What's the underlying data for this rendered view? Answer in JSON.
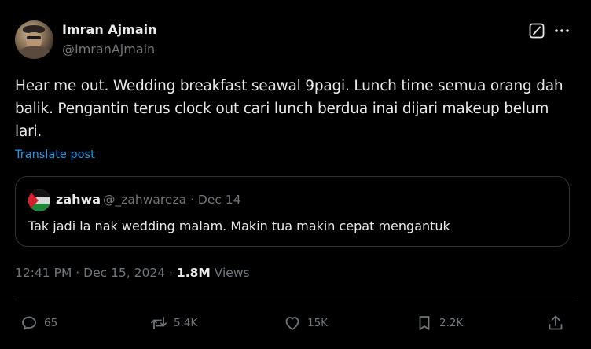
{
  "author": {
    "name": "Imran Ajmain",
    "handle": "@ImranAjmain"
  },
  "icons": {
    "grok": "grok-icon",
    "more": "more-horizontal-icon"
  },
  "tweet": {
    "text": "Hear me out. Wedding breakfast seawal 9pagi. Lunch time semua orang dah balik. Pengantin terus clock out cari lunch berdua inai dijari makeup belum lari.",
    "translate_label": "Translate post"
  },
  "quote": {
    "name": "zahwa",
    "handle": "@_zahwareza",
    "separator": "·",
    "date": "Dec 14",
    "text": "Tak jadi la nak wedding malam. Makin tua makin cepat mengantuk"
  },
  "meta": {
    "time": "12:41 PM",
    "separator": "·",
    "date": "Dec 15, 2024",
    "views_count": "1.8M",
    "views_label": "Views"
  },
  "actions": {
    "replies": "65",
    "reposts": "5.4K",
    "likes": "15K",
    "bookmarks": "2.2K"
  },
  "colors": {
    "background": "#000000",
    "text": "#e7e9ea",
    "secondary": "#71767b",
    "link": "#1d9bf0",
    "border": "#2f3336"
  }
}
